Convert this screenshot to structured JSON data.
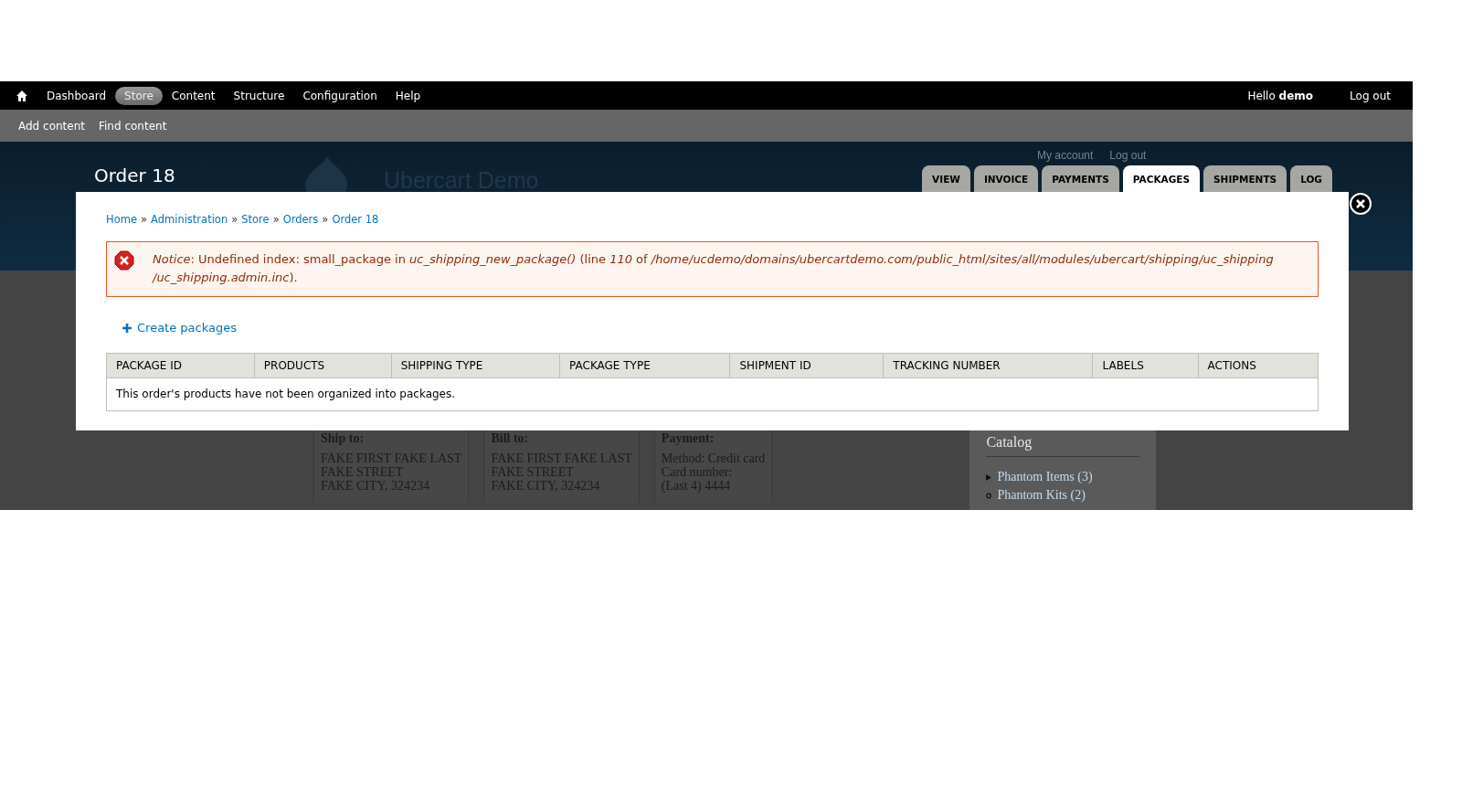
{
  "toolbar": {
    "items": [
      {
        "label": "Dashboard",
        "selected": false
      },
      {
        "label": "Store",
        "selected": true
      },
      {
        "label": "Content",
        "selected": false
      },
      {
        "label": "Structure",
        "selected": false
      },
      {
        "label": "Configuration",
        "selected": false
      },
      {
        "label": "Help",
        "selected": false
      }
    ],
    "greeting": "Hello **demo**",
    "logout": "Log out"
  },
  "shortcuts": [
    "Add content",
    "Find content"
  ],
  "header": {
    "title": "Order 18",
    "site_name": "Ubercart Demo",
    "user_links": [
      "My account",
      "Log out"
    ]
  },
  "tabs": [
    {
      "label": "VIEW",
      "selected": false
    },
    {
      "label": "INVOICE",
      "selected": false
    },
    {
      "label": "PAYMENTS",
      "selected": false
    },
    {
      "label": "PACKAGES",
      "selected": true
    },
    {
      "label": "SHIPMENTS",
      "selected": false
    },
    {
      "label": "LOG",
      "selected": false
    }
  ],
  "modal": {
    "breadcrumb": [
      {
        "kind": "link",
        "label": "Home"
      },
      {
        "kind": "separator",
        "label": "»"
      },
      {
        "kind": "link",
        "label": "Administration"
      },
      {
        "kind": "separator",
        "label": "»"
      },
      {
        "kind": "link",
        "label": "Store"
      },
      {
        "kind": "separator",
        "label": "»"
      },
      {
        "kind": "link",
        "label": "Orders"
      },
      {
        "kind": "separator",
        "label": "»"
      },
      {
        "kind": "link",
        "label": "Order 18"
      }
    ],
    "message": {
      "kind": "error",
      "text": "*Notice*: Undefined index: small_package in *uc_shipping_new_package()* (line *110* of */home/ucdemo/domains/ubercartdemo.com/public_html/sites/all/modules/ubercart/shipping/uc_shipping/uc_shipping.admin.inc*)."
    },
    "action": "Create packages",
    "table": {
      "columns": [
        "PACKAGE ID",
        "PRODUCTS",
        "SHIPPING TYPE",
        "PACKAGE TYPE",
        "SHIPMENT ID",
        "TRACKING NUMBER",
        "LABELS",
        "ACTIONS"
      ],
      "empty_text": "This order's products have not been organized into packages."
    }
  },
  "background_page": {
    "panes": [
      {
        "title": "Ship to:",
        "lines": [
          "FAKE FIRST FAKE LAST",
          "FAKE STREET",
          "FAKE CITY, 324234"
        ]
      },
      {
        "title": "Bill to:",
        "lines": [
          "FAKE FIRST FAKE LAST",
          "FAKE STREET",
          "FAKE CITY, 324234"
        ]
      },
      {
        "title": "Payment:",
        "lines": [
          "Method: Credit card",
          "Card number:",
          "(Last 4) 4444"
        ]
      }
    ],
    "sidebar": {
      "title": "Catalog",
      "items": [
        {
          "label": "Phantom Items (3)",
          "kind": "collapsed"
        },
        {
          "label": "Phantom Kits (2)",
          "kind": "leaf"
        }
      ]
    }
  }
}
